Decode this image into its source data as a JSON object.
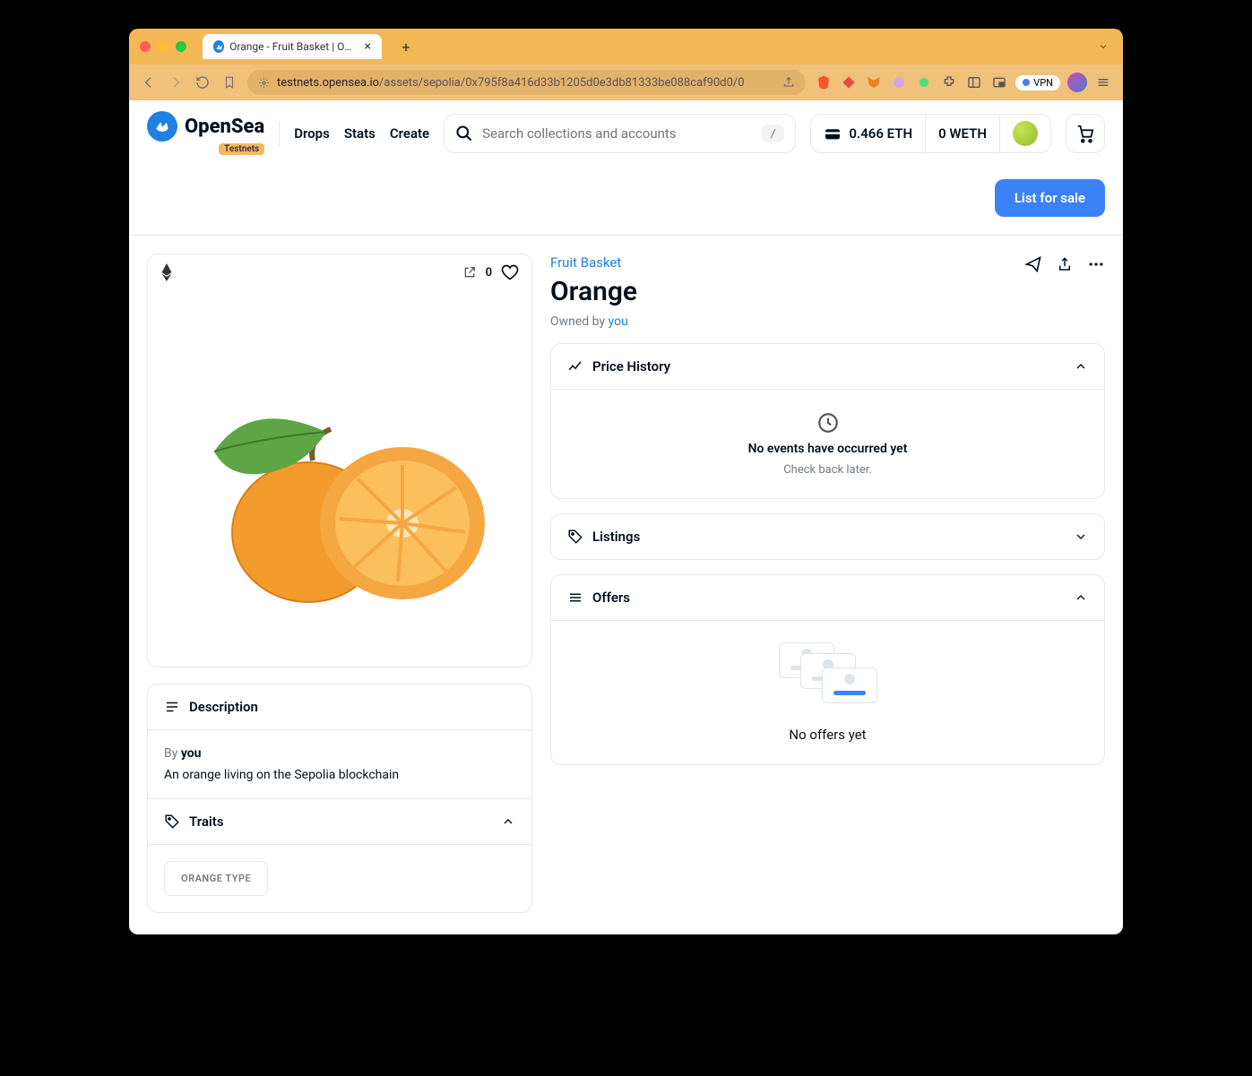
{
  "browser": {
    "tab_title": "Orange - Fruit Basket | OpenSe",
    "url_prefix": "testnets.opensea.io",
    "url_path": "/assets/sepolia/0x795f8a416d33b1205d0e3db81333be088caf90d0/0",
    "vpn_label": "VPN"
  },
  "nav": {
    "brand": "OpenSea",
    "testnets_badge": "Testnets",
    "links": [
      "Drops",
      "Stats",
      "Create"
    ],
    "search_placeholder": "Search collections and accounts",
    "kbd": "/",
    "eth_balance": "0.466 ETH",
    "weth_balance": "0 WETH"
  },
  "actions": {
    "list_for_sale": "List for sale"
  },
  "item": {
    "collection": "Fruit Basket",
    "title": "Orange",
    "owned_by_label": "Owned by ",
    "owned_by_link": "you",
    "likes": "0"
  },
  "panels": {
    "price_history": {
      "title": "Price History",
      "empty_title": "No events have occurred yet",
      "empty_sub": "Check back later."
    },
    "listings": {
      "title": "Listings"
    },
    "offers": {
      "title": "Offers",
      "empty": "No offers yet"
    },
    "description": {
      "title": "Description",
      "by_label": "By ",
      "by_name": "you",
      "text": "An orange living on the Sepolia blockchain"
    },
    "traits": {
      "title": "Traits",
      "chip": "ORANGE TYPE"
    }
  }
}
